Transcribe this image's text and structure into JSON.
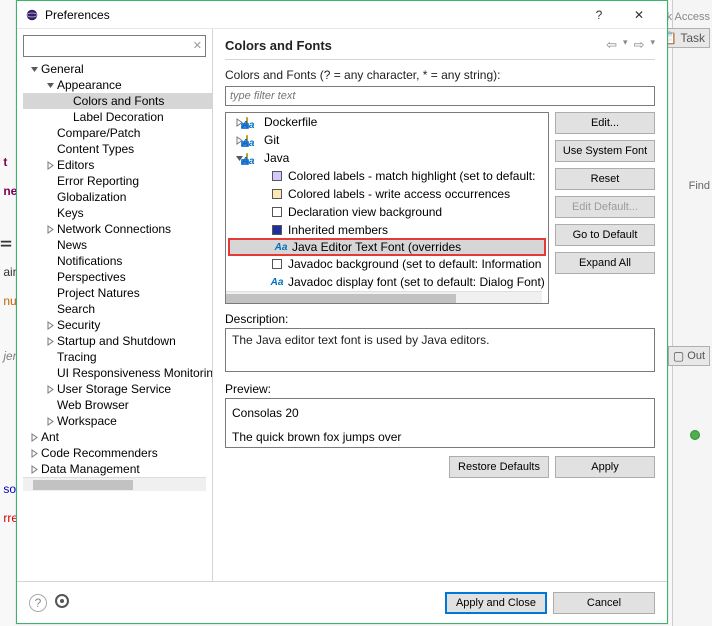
{
  "dialog": {
    "title": "Preferences",
    "search_placeholder": "",
    "tree": [
      {
        "label": "General",
        "depth": 0,
        "arrow": "down"
      },
      {
        "label": "Appearance",
        "depth": 1,
        "arrow": "down"
      },
      {
        "label": "Colors and Fonts",
        "depth": 2,
        "selected": true
      },
      {
        "label": "Label Decoration",
        "depth": 2
      },
      {
        "label": "Compare/Patch",
        "depth": 1
      },
      {
        "label": "Content Types",
        "depth": 1
      },
      {
        "label": "Editors",
        "depth": 1,
        "arrow": "right"
      },
      {
        "label": "Error Reporting",
        "depth": 1
      },
      {
        "label": "Globalization",
        "depth": 1
      },
      {
        "label": "Keys",
        "depth": 1
      },
      {
        "label": "Network Connections",
        "depth": 1,
        "arrow": "right"
      },
      {
        "label": "News",
        "depth": 1
      },
      {
        "label": "Notifications",
        "depth": 1
      },
      {
        "label": "Perspectives",
        "depth": 1
      },
      {
        "label": "Project Natures",
        "depth": 1
      },
      {
        "label": "Search",
        "depth": 1
      },
      {
        "label": "Security",
        "depth": 1,
        "arrow": "right"
      },
      {
        "label": "Startup and Shutdown",
        "depth": 1,
        "arrow": "right"
      },
      {
        "label": "Tracing",
        "depth": 1
      },
      {
        "label": "UI Responsiveness Monitoring",
        "depth": 1
      },
      {
        "label": "User Storage Service",
        "depth": 1,
        "arrow": "right"
      },
      {
        "label": "Web Browser",
        "depth": 1
      },
      {
        "label": "Workspace",
        "depth": 1,
        "arrow": "right"
      },
      {
        "label": "Ant",
        "depth": 0,
        "arrow": "right"
      },
      {
        "label": "Code Recommenders",
        "depth": 0,
        "arrow": "right"
      },
      {
        "label": "Data Management",
        "depth": 0,
        "arrow": "right"
      }
    ]
  },
  "right": {
    "heading": "Colors and Fonts",
    "filter_label": "Colors and Fonts (? = any character, * = any string):",
    "filter_placeholder": "type filter text",
    "tree": [
      {
        "label": "Dockerfile",
        "depth": 0,
        "arrow": "right",
        "icon": "folder"
      },
      {
        "label": "Git",
        "depth": 0,
        "arrow": "right",
        "icon": "folder"
      },
      {
        "label": "Java",
        "depth": 0,
        "arrow": "down",
        "icon": "folder"
      },
      {
        "label": "Colored labels - match highlight (set to default:",
        "depth": 1,
        "icon": "swatch",
        "color": "#d6c8ff"
      },
      {
        "label": "Colored labels - write access occurrences",
        "depth": 1,
        "icon": "swatch",
        "color": "#fce9b3"
      },
      {
        "label": "Declaration view background",
        "depth": 1,
        "icon": "swatch",
        "color": "#ffffff"
      },
      {
        "label": "Inherited members",
        "depth": 1,
        "icon": "swatch",
        "color": "#1d2f9e"
      },
      {
        "label": "Java Editor Text Font (overrides",
        "depth": 1,
        "icon": "aa",
        "highlighted": true
      },
      {
        "label": "Javadoc background (set to default: Information",
        "depth": 1,
        "icon": "swatch",
        "color": "#ffffff"
      },
      {
        "label": "Javadoc display font (set to default: Dialog Font)",
        "depth": 1,
        "icon": "aa"
      }
    ],
    "buttons": {
      "edit": "Edit...",
      "use_system": "Use System Font",
      "reset": "Reset",
      "edit_default": "Edit Default...",
      "goto_default": "Go to Default",
      "expand_all": "Expand All"
    },
    "desc_label": "Description:",
    "desc_text": "The Java editor text font is used by Java editors.",
    "preview_label": "Preview:",
    "preview_line1": "Consolas 20",
    "preview_line2": "The quick brown fox jumps over",
    "restore_defaults": "Restore Defaults",
    "apply": "Apply"
  },
  "footer": {
    "apply_close": "Apply and Close",
    "cancel": "Cancel"
  },
  "bg": {
    "quick_access": "uick Access",
    "task_tab": "Task",
    "find": "Find",
    "outline": "Outline",
    "code1": "t",
    "code2": "net",
    "code3": "= r",
    "code4": "ain",
    "code5": "num",
    "code6": "jen",
    "code7": "sol",
    "code8": "rre"
  }
}
